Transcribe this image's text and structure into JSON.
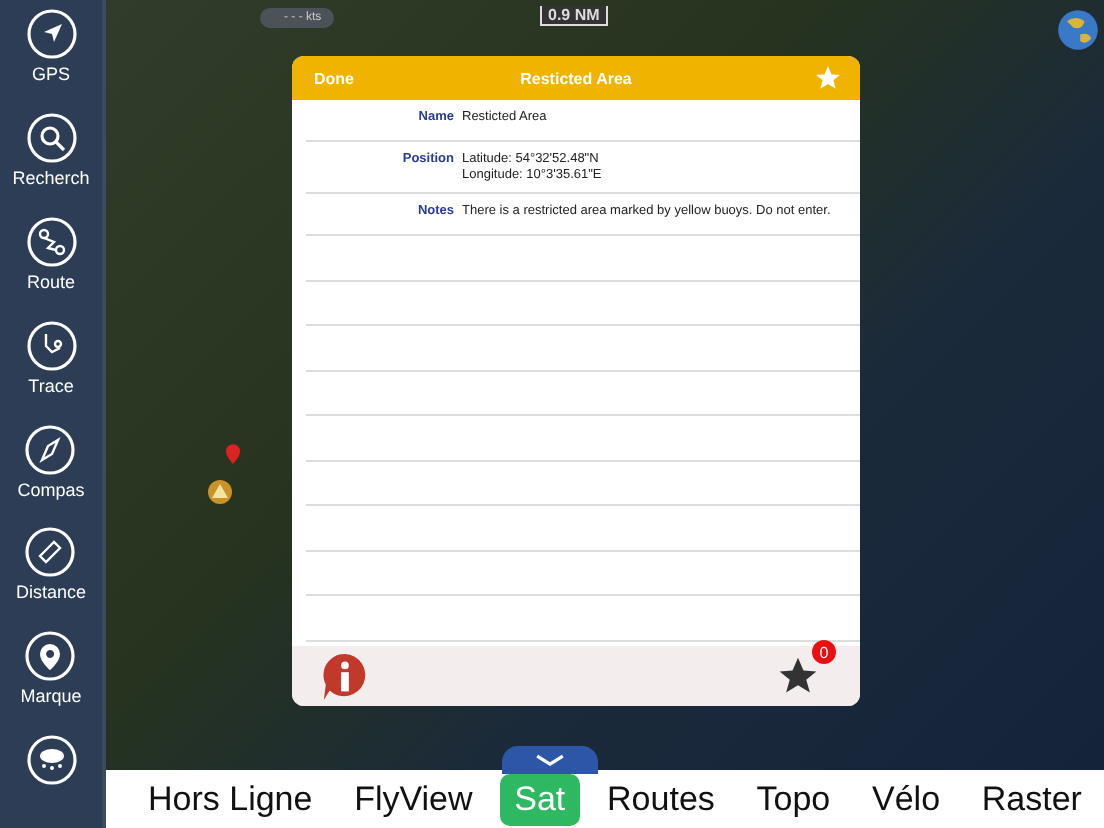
{
  "sidebar": {
    "items": [
      {
        "kind": "gps",
        "label": "GPS"
      },
      {
        "kind": "search",
        "label": "Recherch"
      },
      {
        "kind": "route",
        "label": "Route"
      },
      {
        "kind": "trace",
        "label": "Trace"
      },
      {
        "kind": "compass",
        "label": "Compas"
      },
      {
        "kind": "ruler",
        "label": "Distance"
      },
      {
        "kind": "pin",
        "label": "Marque"
      },
      {
        "kind": "weather"
      }
    ]
  },
  "map": {
    "speed": "- - - kts",
    "scale": "0.9 NM"
  },
  "dialog": {
    "done": "Done",
    "title": "Resticted Area",
    "favorite": true,
    "fields": [
      {
        "label": "Name",
        "lines": [
          "Resticted Area"
        ]
      },
      {
        "label": "Position",
        "lines": [
          "Latitude: 54°32'52.48\"N",
          "Longitude: 10°3'35.61\"E"
        ]
      },
      {
        "label": "Notes",
        "lines": [
          "There is a restricted area marked by yellow buoys.  Do not enter."
        ]
      }
    ],
    "badge": "0"
  },
  "layers": [
    {
      "label": "Hors Ligne",
      "selected": false
    },
    {
      "label": "FlyView",
      "selected": false
    },
    {
      "label": "Sat",
      "selected": true
    },
    {
      "label": "Routes",
      "selected": false
    },
    {
      "label": "Topo",
      "selected": false
    },
    {
      "label": "Vélo",
      "selected": false
    },
    {
      "label": "Raster",
      "selected": false
    }
  ]
}
